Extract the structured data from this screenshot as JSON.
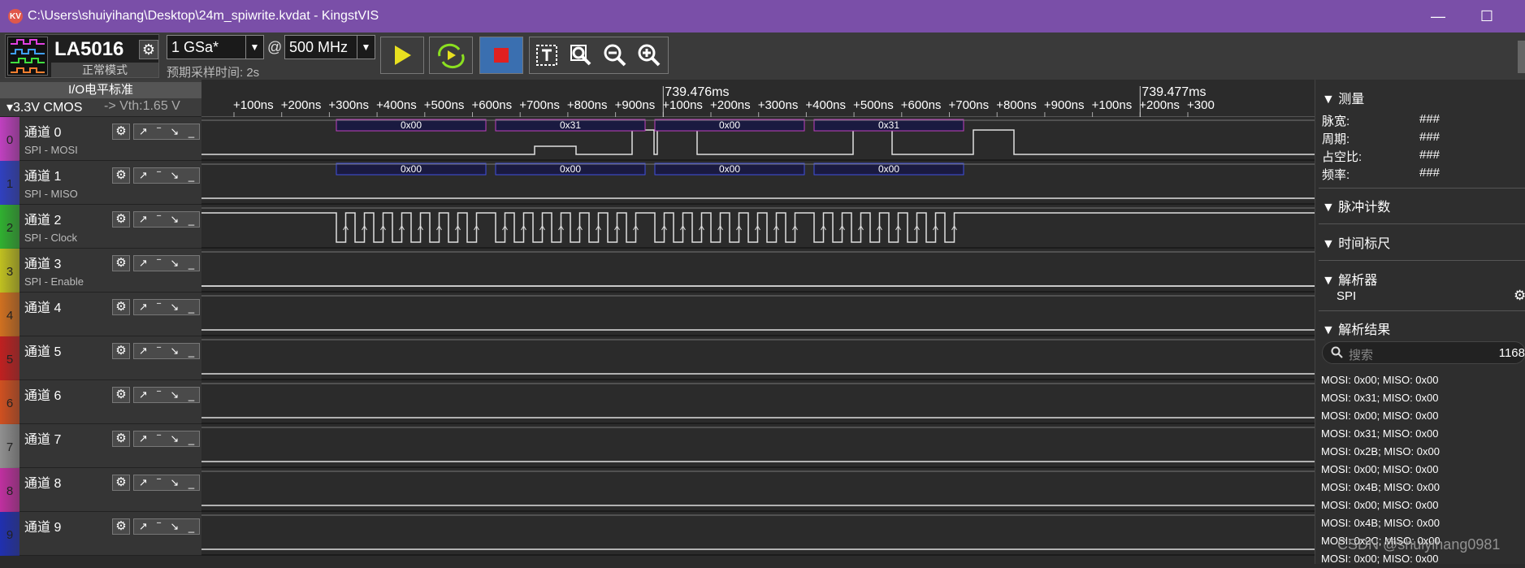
{
  "window": {
    "title": "C:\\Users\\shuiyihang\\Desktop\\24m_spiwrite.kvdat - KingstVIS",
    "app_icon": "KV",
    "minimize": "—",
    "maximize": "☐"
  },
  "device": {
    "name": "LA5016",
    "mode": "正常模式",
    "gear": "⚙"
  },
  "sample_rate": {
    "value": "1 GSa*",
    "arrow": "▼"
  },
  "at_sign": "@",
  "freq": {
    "value": "500 MHz",
    "arrow": "▼"
  },
  "sample_time": "预期采样时间: 2s",
  "io_standard": {
    "title": "I/O电平标准",
    "level": "▾3.3V CMOS",
    "vth": "-> Vth:1.65 V"
  },
  "ruler": {
    "majors": [
      "739.476ms",
      "739.477ms"
    ],
    "ticks": [
      "+100ns",
      "+200ns",
      "+300ns",
      "+400ns",
      "+500ns",
      "+600ns",
      "+700ns",
      "+800ns",
      "+900ns",
      "+100ns",
      "+200ns",
      "+300ns",
      "+400ns",
      "+500ns",
      "+600ns",
      "+700ns",
      "+800ns",
      "+900ns",
      "+100ns",
      "+200ns",
      "+300"
    ]
  },
  "channels": [
    {
      "num": "0",
      "name": "通道 0",
      "sub": "SPI - MOSI",
      "color": "#c040c0"
    },
    {
      "num": "1",
      "name": "通道 1",
      "sub": "SPI - MISO",
      "color": "#3040c0"
    },
    {
      "num": "2",
      "name": "通道 2",
      "sub": "SPI - Clock",
      "color": "#30b030"
    },
    {
      "num": "3",
      "name": "通道 3",
      "sub": "SPI - Enable",
      "color": "#c0c020"
    },
    {
      "num": "4",
      "name": "通道 4",
      "sub": "",
      "color": "#d07020"
    },
    {
      "num": "5",
      "name": "通道 5",
      "sub": "",
      "color": "#c02020"
    },
    {
      "num": "6",
      "name": "通道 6",
      "sub": "",
      "color": "#d05020"
    },
    {
      "num": "7",
      "name": "通道 7",
      "sub": "",
      "color": "#909090"
    },
    {
      "num": "8",
      "name": "通道 8",
      "sub": "",
      "color": "#c030a0"
    },
    {
      "num": "9",
      "name": "通道 9",
      "sub": "",
      "color": "#2030b0"
    }
  ],
  "channel_gear": "⚙",
  "trigger_glyphs": [
    "↗",
    "‾",
    "↘",
    "_"
  ],
  "decode": {
    "mosi": [
      "0x00",
      "0x31",
      "0x00",
      "0x31"
    ],
    "miso": [
      "0x00",
      "0x00",
      "0x00",
      "0x00"
    ]
  },
  "panel": {
    "measure": "▼ 测量",
    "pulse_width_label": "脉宽:",
    "pulse_width": "###",
    "period_label": "周期:",
    "period": "###",
    "duty_label": "占空比:",
    "duty": "###",
    "freq_label": "频率:",
    "freq": "###",
    "pulse_count": "▼ 脉冲计数",
    "time_marker": "▼ 时间标尺",
    "analyzer": "▼ 解析器",
    "analyzer_item": "SPI",
    "analyzer_gear": "⚙",
    "results": "▼ 解析结果",
    "search_placeholder": "搜索",
    "result_count": "1168",
    "result_rows": [
      "MOSI: 0x00;  MISO: 0x00",
      "MOSI: 0x31;  MISO: 0x00",
      "MOSI: 0x00;  MISO: 0x00",
      "MOSI: 0x31;  MISO: 0x00",
      "MOSI: 0x2B;  MISO: 0x00",
      "MOSI: 0x00;  MISO: 0x00",
      "MOSI: 0x4B;  MISO: 0x00",
      "MOSI: 0x00;  MISO: 0x00",
      "MOSI: 0x4B;  MISO: 0x00",
      "MOSI: 0x2C;  MISO: 0x00",
      "MOSI: 0x00;  MISO: 0x00"
    ]
  },
  "watermark": "CSDN @shuiyihang0981"
}
